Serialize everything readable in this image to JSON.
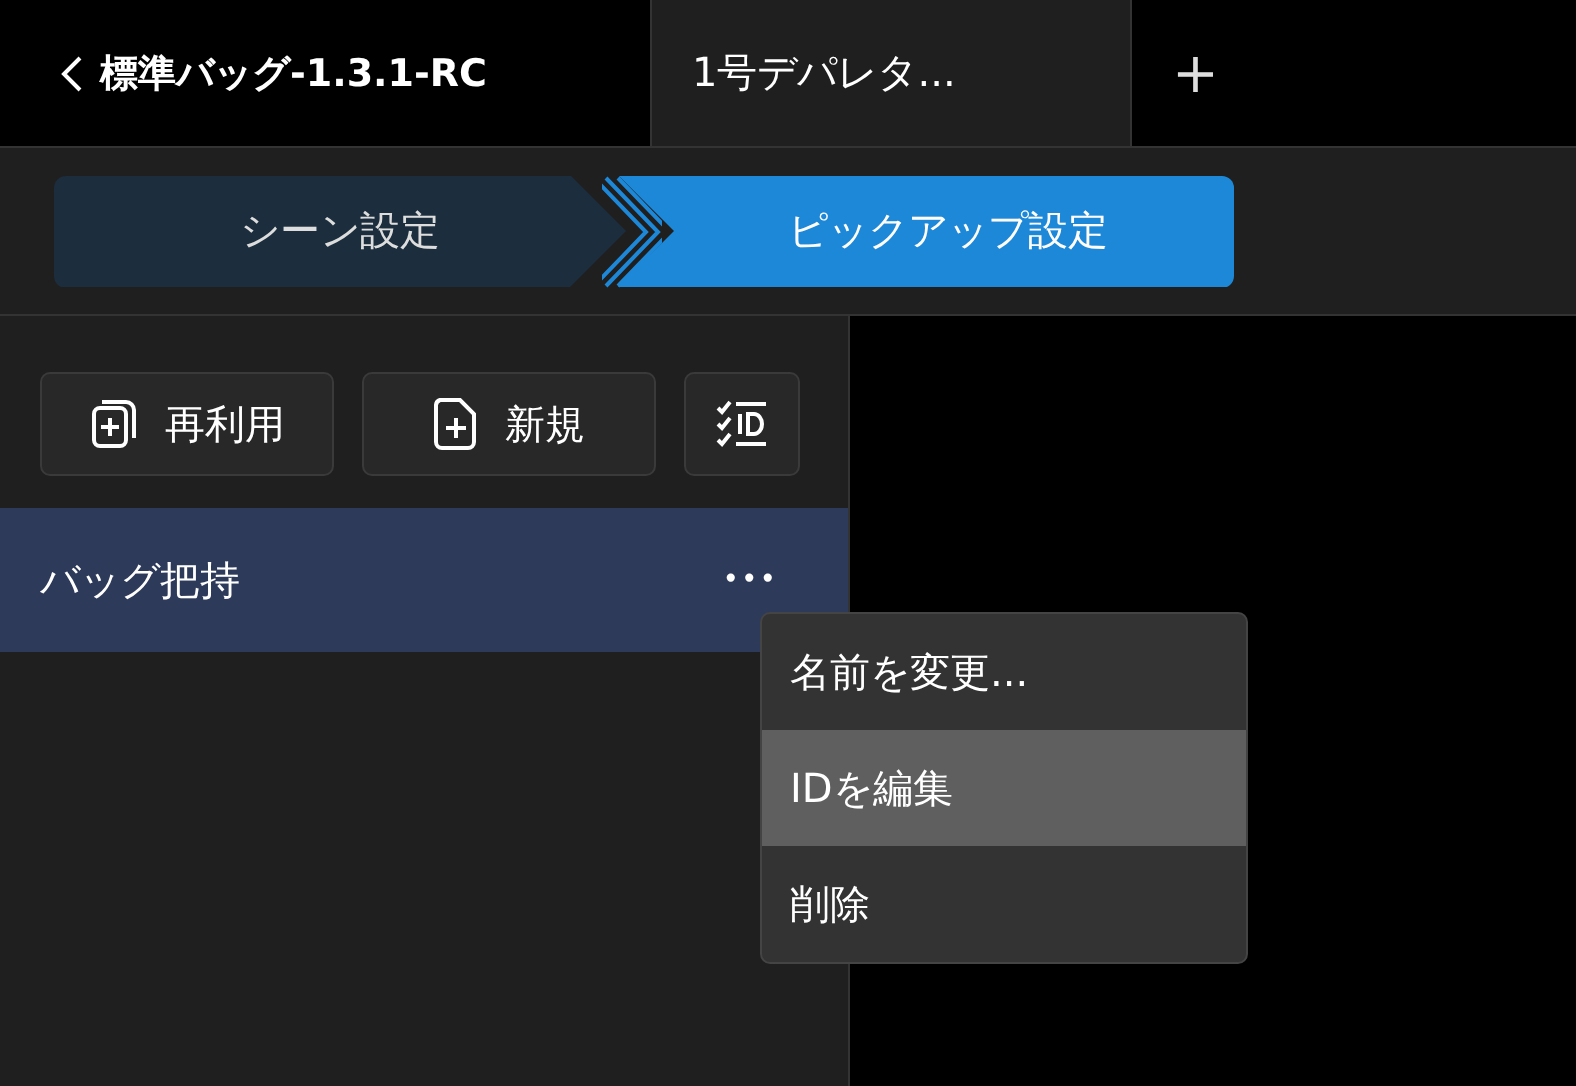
{
  "tabs": [
    {
      "label": "標準バッグ-1.3.1-RC",
      "kind": "back",
      "selected": false
    },
    {
      "label": "1号デパレタ...",
      "kind": "doc",
      "selected": true
    },
    {
      "label": "+",
      "kind": "add",
      "selected": false
    }
  ],
  "steps": [
    {
      "label": "シーン設定",
      "selected": false
    },
    {
      "label": "ピックアップ設定",
      "selected": true
    }
  ],
  "toolbar": [
    {
      "label": "再利用",
      "kind": "reuse"
    },
    {
      "label": "新規",
      "kind": "new"
    },
    {
      "kind": "id-list"
    }
  ],
  "list": [
    {
      "label": "バッグ把持",
      "selected": true,
      "more": "•••"
    }
  ],
  "context_menu": [
    {
      "label": "名前を変更...",
      "selected": false
    },
    {
      "label": "IDを編集",
      "selected": true
    },
    {
      "label": "削除",
      "selected": false
    }
  ]
}
